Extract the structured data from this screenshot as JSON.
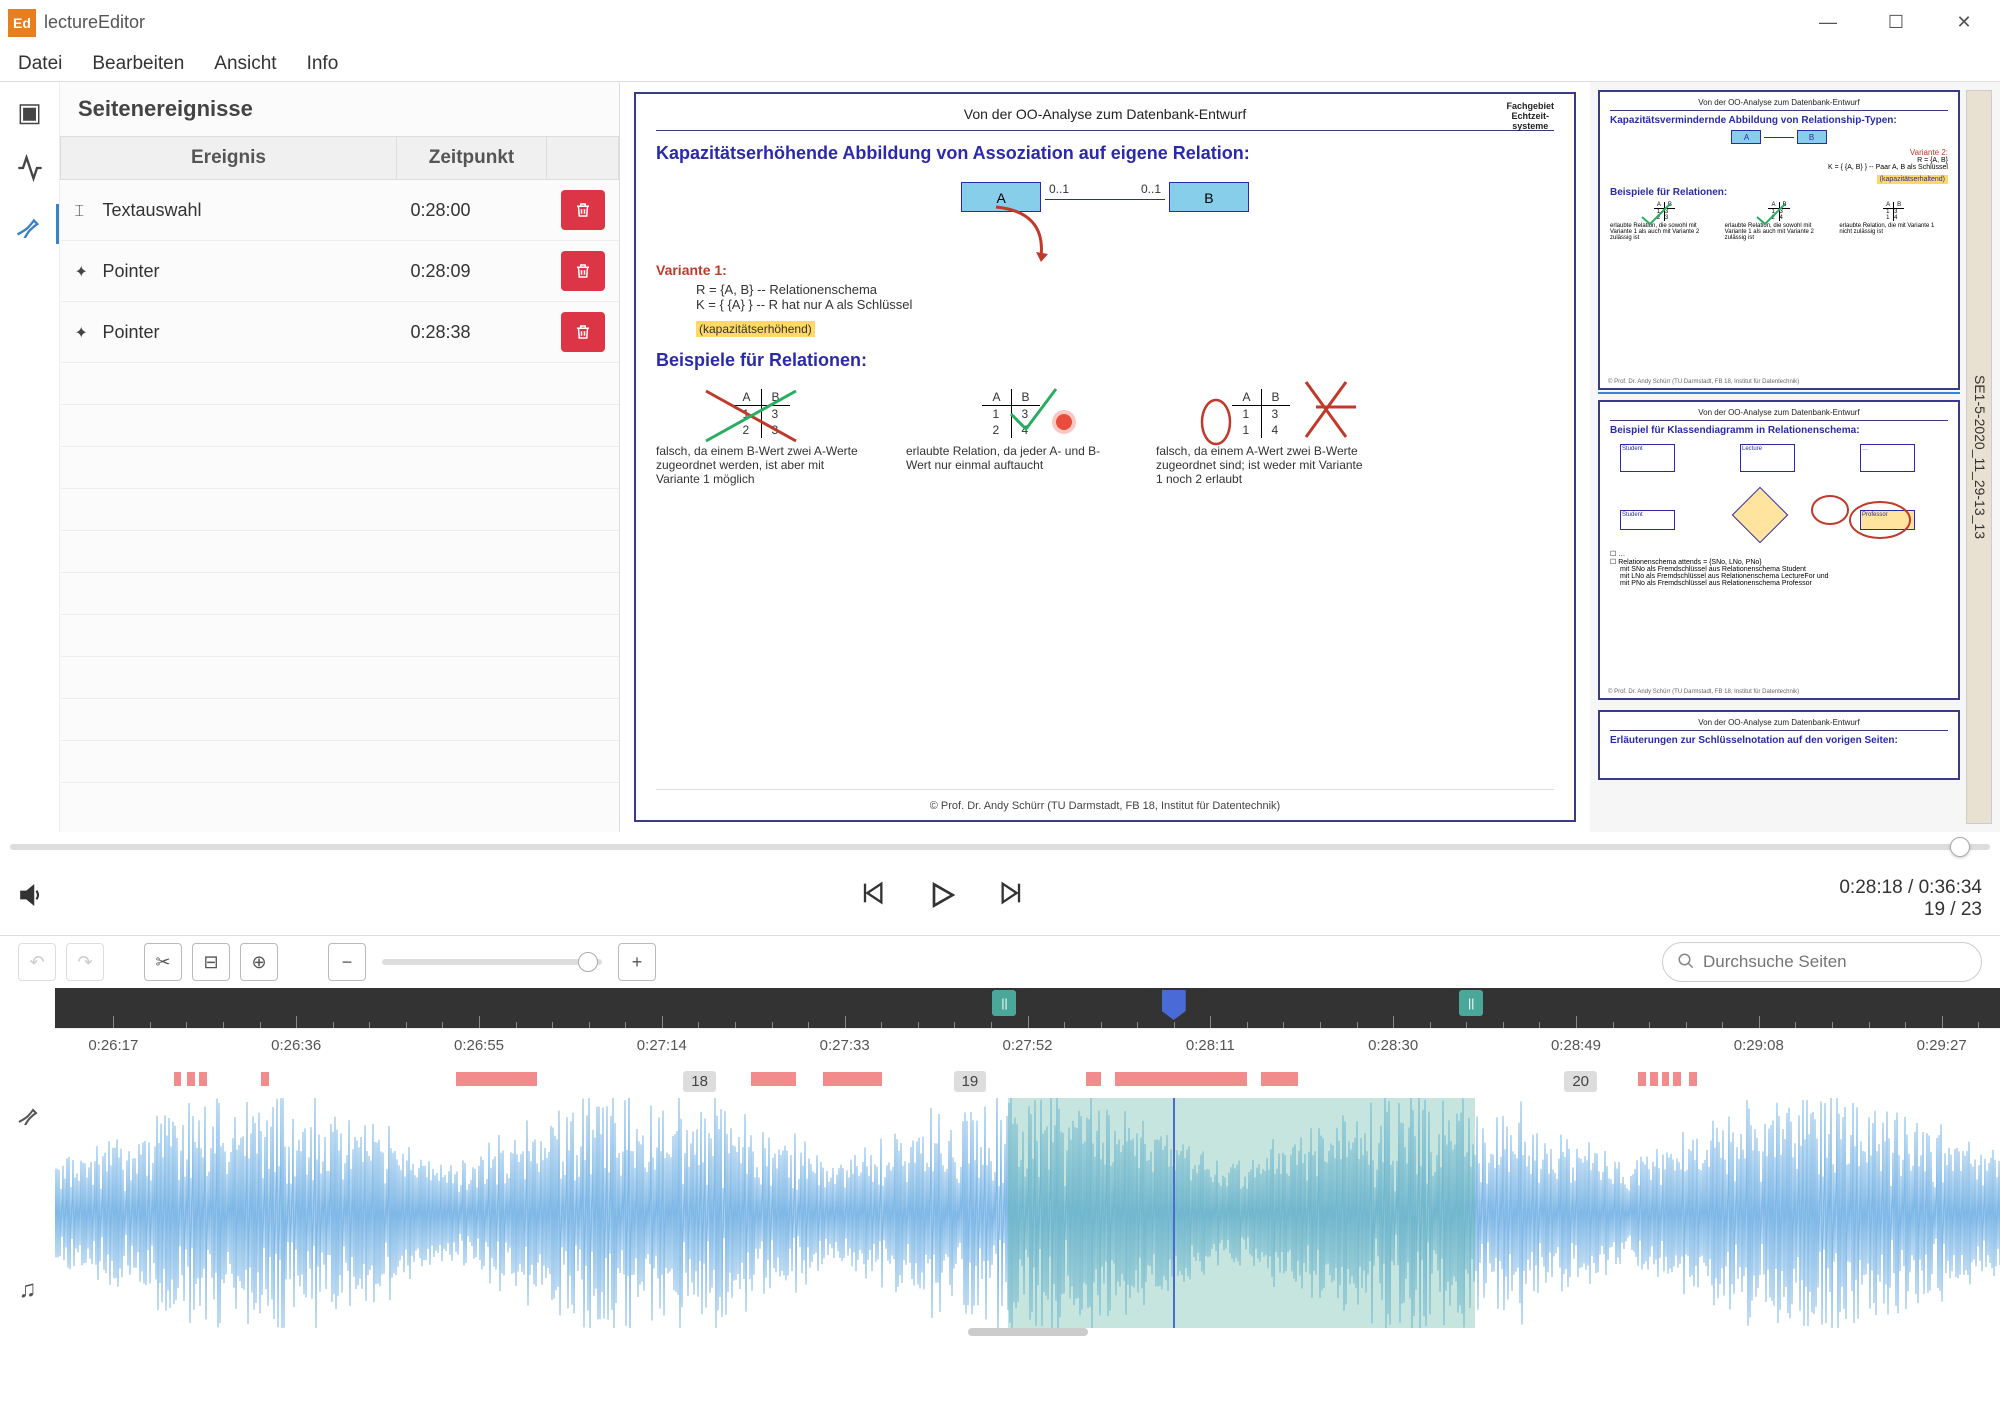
{
  "app": {
    "icon_text": "Ed",
    "title": "lectureEditor"
  },
  "menu": {
    "file": "Datei",
    "edit": "Bearbeiten",
    "view": "Ansicht",
    "info": "Info"
  },
  "events": {
    "title": "Seitenereignisse",
    "col_event": "Ereignis",
    "col_time": "Zeitpunkt",
    "rows": [
      {
        "icon": "⌶",
        "label": "Textauswahl",
        "time": "0:28:00"
      },
      {
        "icon": "✦",
        "label": "Pointer",
        "time": "0:28:09"
      },
      {
        "icon": "✦",
        "label": "Pointer",
        "time": "0:28:38"
      }
    ]
  },
  "slide": {
    "top_title": "Von der OO-Analyse zum Datenbank-Entwurf",
    "fachgebiet": "Fachgebiet\nEchtzeit-\nsysteme",
    "h2": "Kapazitätserhöhende Abbildung von Assoziation auf eigene Relation:",
    "entA": "A",
    "entB": "B",
    "multA": "0..1",
    "multB": "0..1",
    "variant": "Variante 1:",
    "schema1": "R = {A, B}   -- Relationenschema",
    "schema2": "K = { {A} }   -- R hat nur A als Schlüssel",
    "annot": "(kapazitätserhöhend)",
    "h3": "Beispiele für Relationen:",
    "cap1": "falsch, da einem B-Wert zwei A-Werte zugeordnet werden, ist aber mit Variante 1 möglich",
    "cap2": "erlaubte Relation, da jeder A- und B-Wert nur einmal auftaucht",
    "cap3": "falsch, da einem A-Wert zwei B-Werte zugeordnet sind; ist weder mit Variante 1 noch 2 erlaubt",
    "footer": "© Prof. Dr. Andy Schürr (TU Darmstadt, FB 18, Institut für Datentechnik)"
  },
  "thumbs": {
    "file_tab": "SE1-5-2020_11_29-13_13",
    "t1_title": "Kapazitätsvermindernde Abbildung von Relationship-Typen:",
    "t1_var": "Variante 2:",
    "t1_s1": "R = {A, B}",
    "t1_s2": "K = { {A, B} } -- Paar A, B als Schlüssel",
    "t1_annot": "(kapazitätserhaltend)",
    "t1_bsp": "Beispiele für Relationen:",
    "t1_c1": "erlaubte Relation, die sowohl mit Variante 1 als auch mit Variante 2 zulässig ist",
    "t1_c2": "erlaubte Relation, die sowohl mit Variante 1 als auch mit Variante 2 zulässig ist",
    "t1_c3": "erlaubte Relation, die mit Variante 1 nicht zulässig ist",
    "t2_title": "Beispiel für Klassendiagramm in Relationenschema:",
    "t2_b1": "Relationenschema attends = {SNo, LNo, PNo}",
    "t2_b2": "mit SNo als Fremdschlüssel aus Relationenschema Student",
    "t2_b3": "mit LNo als Fremdschlüssel aus Relationenschema LectureFor und",
    "t2_b4": "mit PNo als Fremdschlüssel aus Relationenschema Professor",
    "t3_title": "Erläuterungen zur Schlüsselnotation auf den vorigen Seiten:"
  },
  "playback": {
    "current": "0:28:18",
    "total": "0:36:34",
    "page": "19",
    "pages": "23",
    "search_placeholder": "Durchsuche Seiten"
  },
  "timeline": {
    "ticks": [
      "0:26:17",
      "0:26:36",
      "0:26:55",
      "0:27:14",
      "0:27:33",
      "0:27:52",
      "0:28:11",
      "0:28:30",
      "0:28:49",
      "0:29:08",
      "0:29:27"
    ],
    "page_badges": [
      {
        "label": "18",
        "left_pct": 32.3
      },
      {
        "label": "19",
        "left_pct": 46.2
      },
      {
        "label": "20",
        "left_pct": 77.6
      }
    ],
    "markers": [
      {
        "left_pct": 6.1,
        "width_pct": 0.4
      },
      {
        "left_pct": 6.8,
        "width_pct": 0.4
      },
      {
        "left_pct": 7.4,
        "width_pct": 0.4
      },
      {
        "left_pct": 10.6,
        "width_pct": 0.4
      },
      {
        "left_pct": 20.6,
        "width_pct": 4.2
      },
      {
        "left_pct": 35.8,
        "width_pct": 2.3
      },
      {
        "left_pct": 39.5,
        "width_pct": 3.0
      },
      {
        "left_pct": 53.0,
        "width_pct": 0.8
      },
      {
        "left_pct": 54.5,
        "width_pct": 6.8
      },
      {
        "left_pct": 62.0,
        "width_pct": 1.9
      },
      {
        "left_pct": 81.4,
        "width_pct": 0.4
      },
      {
        "left_pct": 82.0,
        "width_pct": 0.4
      },
      {
        "left_pct": 82.6,
        "width_pct": 0.4
      },
      {
        "left_pct": 83.2,
        "width_pct": 0.4
      },
      {
        "left_pct": 84.0,
        "width_pct": 0.4
      }
    ],
    "selection": {
      "start_pct": 49.0,
      "end_pct": 73.0
    },
    "playhead_pct": 57.5
  }
}
